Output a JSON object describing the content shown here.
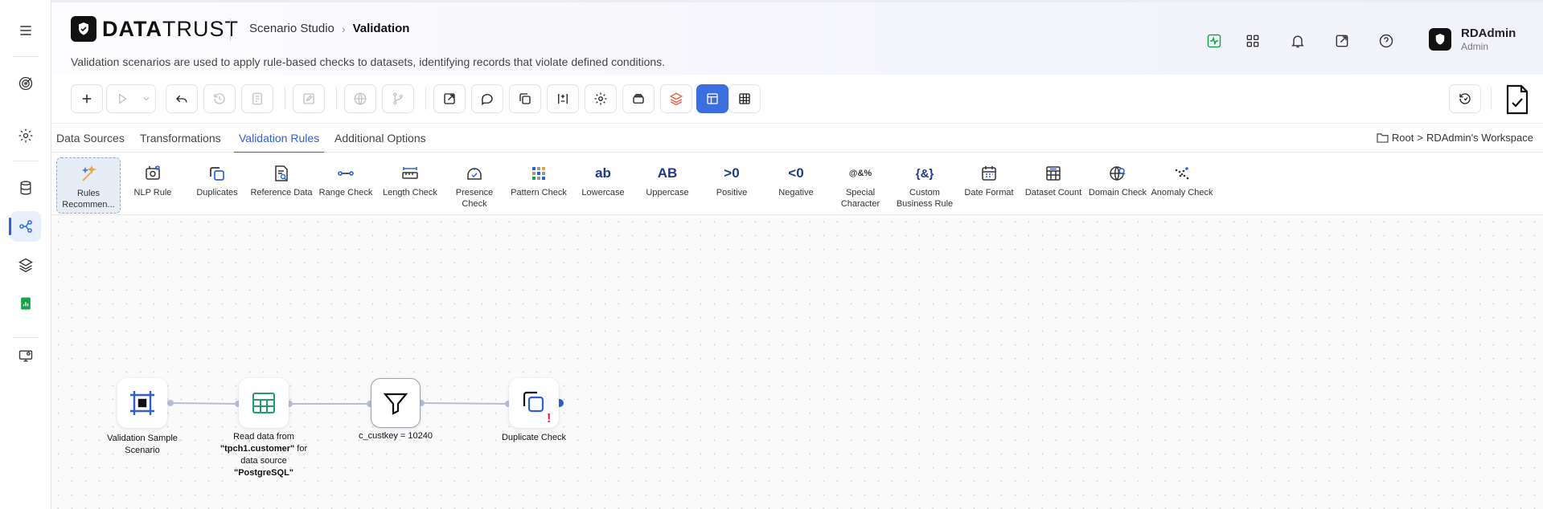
{
  "app": {
    "brand_bold": "DATA",
    "brand_light": "TRUST",
    "breadcrumb": [
      "Scenario Studio",
      "Validation"
    ],
    "description": "Validation scenarios are used to apply rule-based checks to datasets, identifying records that violate defined conditions."
  },
  "user": {
    "name": "RDAdmin",
    "role": "Admin"
  },
  "tabs": [
    {
      "label": "Data Sources"
    },
    {
      "label": "Transformations"
    },
    {
      "label": "Validation Rules",
      "active": true
    },
    {
      "label": "Additional Options"
    }
  ],
  "workspace": {
    "root": "Root",
    "name": "RDAdmin's Workspace"
  },
  "rules": [
    {
      "label": "Rules Recommen...",
      "icon": "sparkle-icon"
    },
    {
      "label": "NLP Rule",
      "icon": "nlp-icon"
    },
    {
      "label": "Duplicates",
      "icon": "duplicate-icon"
    },
    {
      "label": "Reference Data",
      "icon": "reference-icon"
    },
    {
      "label": "Range Check",
      "icon": "range-icon"
    },
    {
      "label": "Length Check",
      "icon": "ruler-icon"
    },
    {
      "label": "Presence Check",
      "icon": "presence-icon"
    },
    {
      "label": "Pattern Check",
      "icon": "pattern-icon"
    },
    {
      "label": "Lowercase",
      "icon": "lowercase-icon",
      "glyph": "ab"
    },
    {
      "label": "Uppercase",
      "icon": "uppercase-icon",
      "glyph": "AB"
    },
    {
      "label": "Positive",
      "icon": "positive-icon",
      "glyph": ">0"
    },
    {
      "label": "Negative",
      "icon": "negative-icon",
      "glyph": "<0"
    },
    {
      "label": "Special Character",
      "icon": "special-char-icon",
      "glyph": "@&%"
    },
    {
      "label": "Custom Business Rule",
      "icon": "custom-rule-icon",
      "glyph": "{&}"
    },
    {
      "label": "Date Format",
      "icon": "calendar-icon"
    },
    {
      "label": "Dataset Count",
      "icon": "dataset-count-icon"
    },
    {
      "label": "Domain Check",
      "icon": "domain-icon"
    },
    {
      "label": "Anomaly Check",
      "icon": "anomaly-icon"
    }
  ],
  "nodes": [
    {
      "label": "Validation Sample Scenario",
      "icon": "scenario-icon"
    },
    {
      "label_parts": [
        "Read data from ",
        "\"tpch1.customer\"",
        " for data source ",
        "\"PostgreSQL\""
      ],
      "icon": "table-icon"
    },
    {
      "label": "c_custkey = 10240",
      "icon": "filter-icon"
    },
    {
      "label": "Duplicate Check",
      "icon": "duplicate-check-icon",
      "warning": "!"
    }
  ],
  "colors": {
    "accent": "#2d5fd3",
    "active_button": "#3b6fe0",
    "edge": "#b5bddb",
    "warning": "#e11d48",
    "success": "#16a34a"
  }
}
